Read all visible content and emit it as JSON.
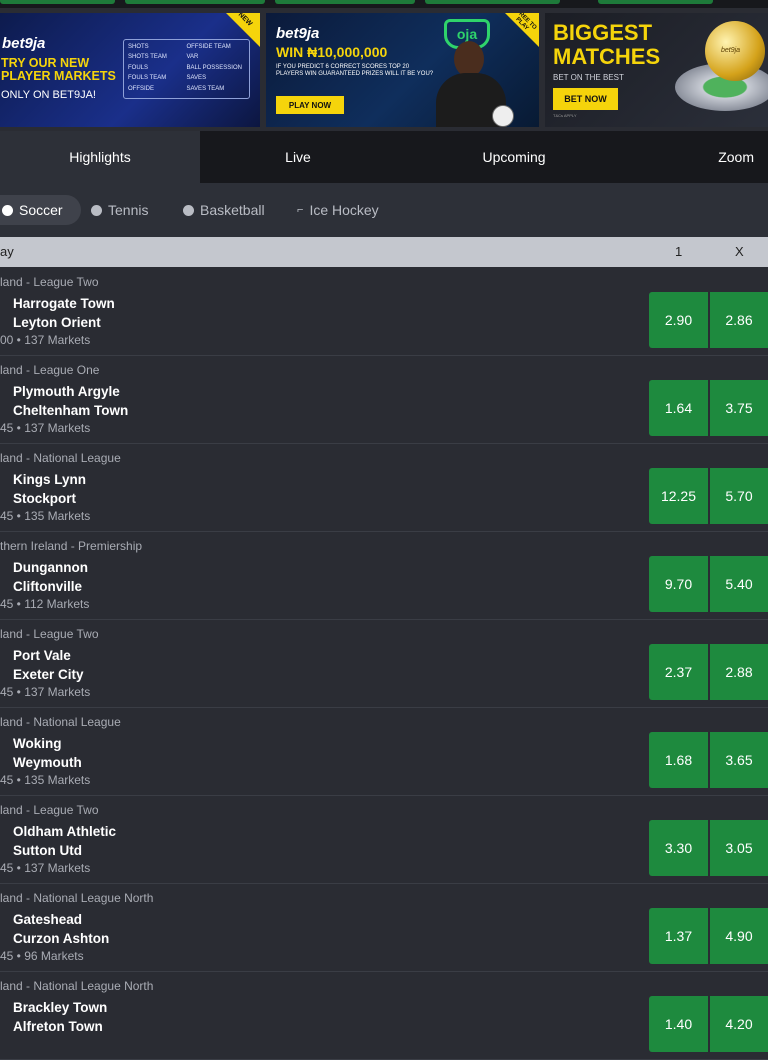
{
  "banners": [
    {
      "logo": "bet9ja",
      "ribbon": "NEW",
      "headline_1": "TRY OUR NEW",
      "headline_2": "PLAYER MARKETS",
      "sub": "ONLY ON BET9JA!",
      "markets": [
        "SHOTS",
        "OFFSIDE TEAM",
        "SHOTS TEAM",
        "VAR",
        "FOULS",
        "BALL POSSESSION",
        "FOULS TEAM",
        "SAVES",
        "OFFSIDE",
        "SAVES TEAM"
      ]
    },
    {
      "logo": "bet9ja",
      "ribbon": "FREE TO PLAY",
      "badge": "oja",
      "headline": "WIN ₦10,000,000",
      "sub": "IF YOU PREDICT 6 CORRECT SCORES TOP 20 PLAYERS WIN GUARANTEED PRIZES WILL IT BE YOU?",
      "button": "PLAY NOW"
    },
    {
      "headline_1": "BIGGEST",
      "headline_2": "MATCHES",
      "sub": "BET ON THE BEST",
      "button": "BET NOW",
      "tiny": "T&Cs APPLY",
      "ball_label": "bet9ja"
    }
  ],
  "tabs": [
    "Highlights",
    "Live",
    "Upcoming",
    "Zoom"
  ],
  "sports": [
    "Soccer",
    "Tennis",
    "Basketball",
    "Ice Hockey"
  ],
  "header": {
    "left": "ay",
    "col1": "1",
    "colx": "X"
  },
  "events": [
    {
      "league": "land - League Two",
      "home": "Harrogate Town",
      "away": "Leyton Orient",
      "meta": "00 • 137 Markets",
      "odd1": "2.90",
      "oddx": "2.86"
    },
    {
      "league": "land - League One",
      "home": "Plymouth Argyle",
      "away": "Cheltenham Town",
      "meta": "45 • 137 Markets",
      "odd1": "1.64",
      "oddx": "3.75"
    },
    {
      "league": "land - National League",
      "home": "Kings Lynn",
      "away": "Stockport",
      "meta": "45 • 135 Markets",
      "odd1": "12.25",
      "oddx": "5.70"
    },
    {
      "league": "thern Ireland - Premiership",
      "home": "Dungannon",
      "away": "Cliftonville",
      "meta": "45 • 112 Markets",
      "odd1": "9.70",
      "oddx": "5.40"
    },
    {
      "league": "land - League Two",
      "home": "Port Vale",
      "away": "Exeter City",
      "meta": "45 • 137 Markets",
      "odd1": "2.37",
      "oddx": "2.88"
    },
    {
      "league": "land - National League",
      "home": "Woking",
      "away": "Weymouth",
      "meta": "45 • 135 Markets",
      "odd1": "1.68",
      "oddx": "3.65"
    },
    {
      "league": "land - League Two",
      "home": "Oldham Athletic",
      "away": "Sutton Utd",
      "meta": "45 • 137 Markets",
      "odd1": "3.30",
      "oddx": "3.05"
    },
    {
      "league": "land - National League North",
      "home": "Gateshead",
      "away": "Curzon Ashton",
      "meta": "45 • 96 Markets",
      "odd1": "1.37",
      "oddx": "4.90"
    },
    {
      "league": "land - National League North",
      "home": "Brackley Town",
      "away": "Alfreton Town",
      "meta": "",
      "odd1": "1.40",
      "oddx": "4.20"
    }
  ]
}
